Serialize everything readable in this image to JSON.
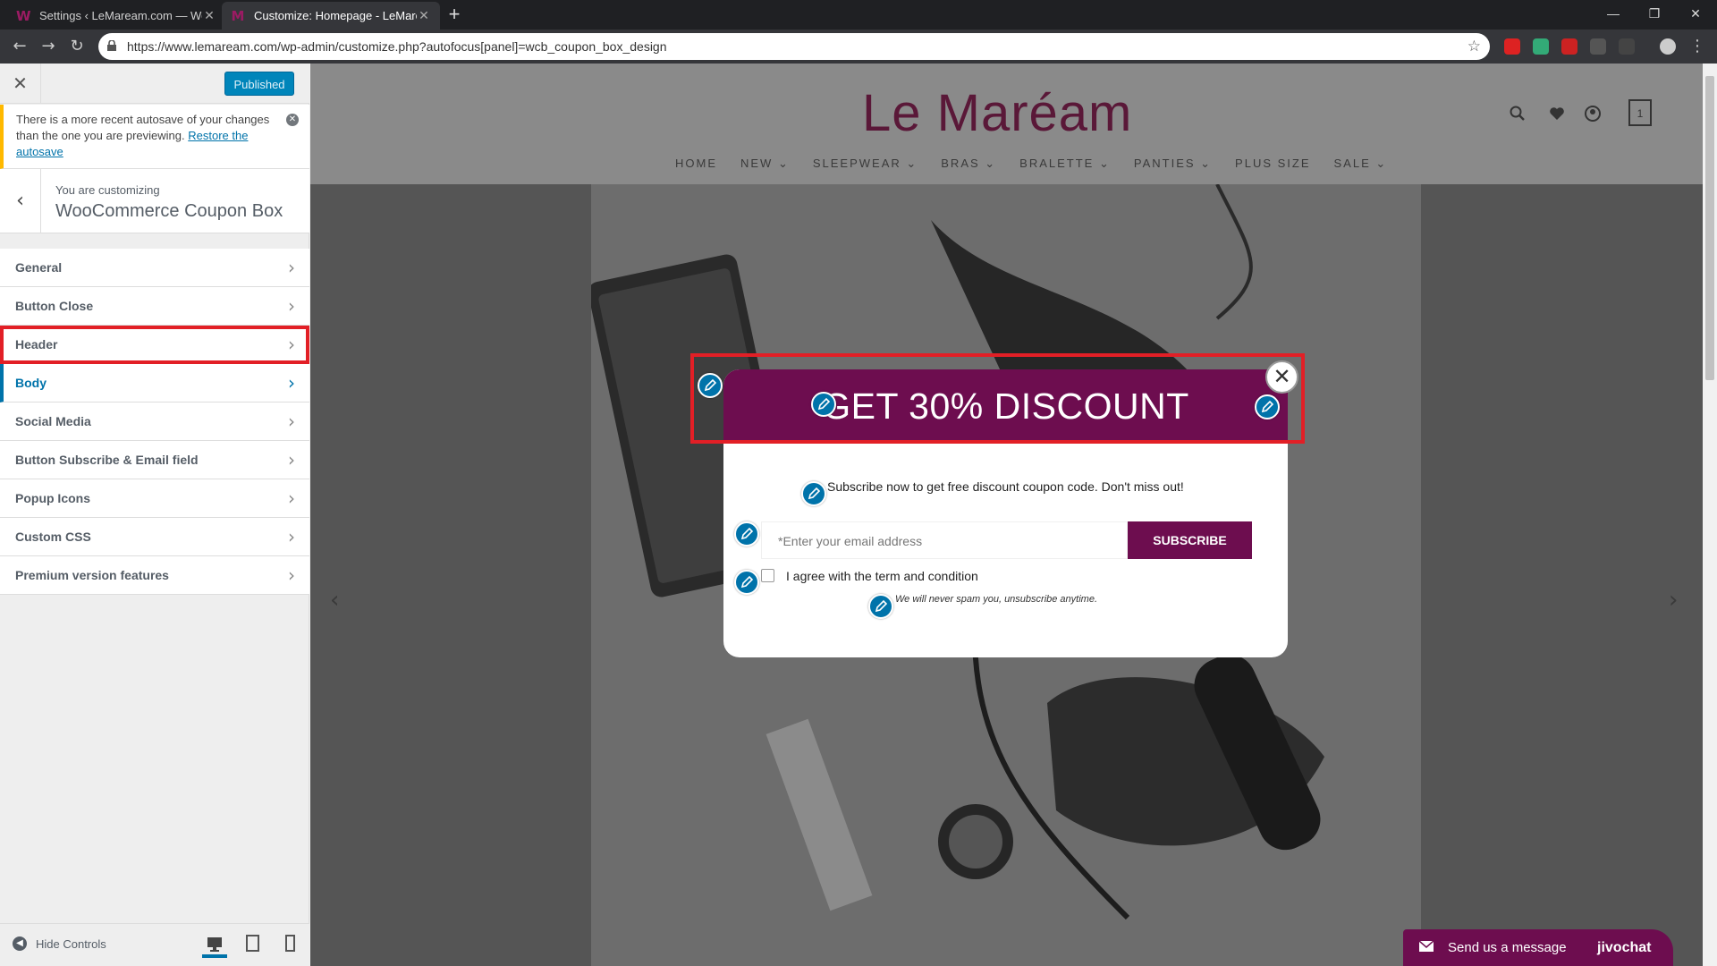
{
  "browser": {
    "tabs": [
      {
        "title": "Settings ‹ LeMaream.com — Wo",
        "active": false
      },
      {
        "title": "Customize: Homepage - LeMare",
        "active": true
      }
    ],
    "url": "https://www.lemaream.com/wp-admin/customize.php?autofocus[panel]=wcb_coupon_box_design"
  },
  "sidebar": {
    "published_label": "Published",
    "notice": {
      "text": "There is a more recent autosave of your changes than the one you are previewing.",
      "link": "Restore the autosave"
    },
    "customizing_label": "You are customizing",
    "section_title": "WooCommerce Coupon Box",
    "items": [
      {
        "label": "General"
      },
      {
        "label": "Button Close"
      },
      {
        "label": "Header"
      },
      {
        "label": "Body"
      },
      {
        "label": "Social Media"
      },
      {
        "label": "Button Subscribe & Email field"
      },
      {
        "label": "Popup Icons"
      },
      {
        "label": "Custom CSS"
      },
      {
        "label": "Premium version features"
      }
    ],
    "hide_controls": "Hide Controls"
  },
  "site": {
    "logo": "Le Maréam",
    "nav": [
      "HOME",
      "NEW ⌄",
      "SLEEPWEAR ⌄",
      "BRAS ⌄",
      "BRALETTE ⌄",
      "PANTIES ⌄",
      "PLUS SIZE",
      "SALE ⌄"
    ],
    "cart_count": "1"
  },
  "popup": {
    "title": "GET 30% DISCOUNT",
    "message": "Subscribe now to get free discount coupon code. Don't miss out!",
    "email_placeholder": "*Enter your email address",
    "subscribe_label": "SUBSCRIBE",
    "agree_label": "I agree with the term and condition",
    "nospam": "We will never spam you, unsubscribe anytime."
  },
  "chat": {
    "message": "Send us a message",
    "brand": "jivochat"
  },
  "colors": {
    "accent": "#6d0d4f",
    "wp_blue": "#0073aa",
    "highlight": "#e21f26"
  }
}
